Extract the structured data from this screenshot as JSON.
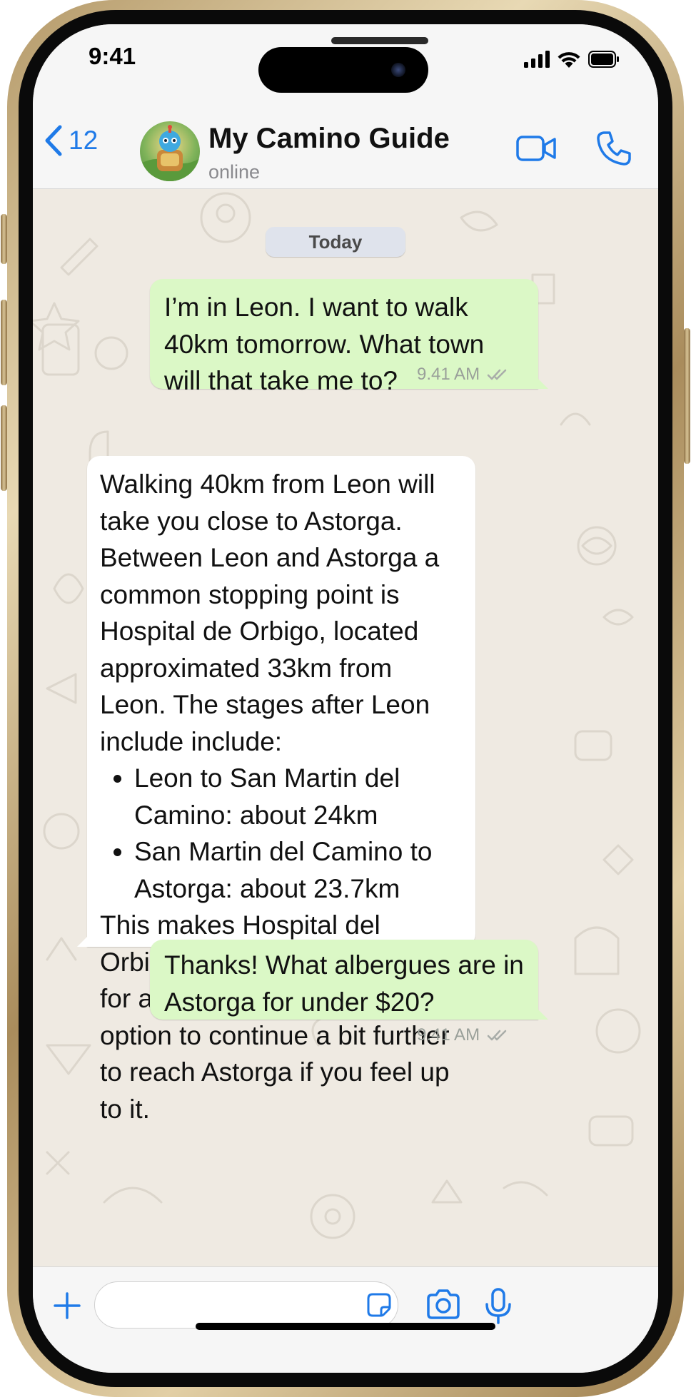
{
  "status_bar": {
    "time": "9:41"
  },
  "header": {
    "back_count": "12",
    "contact_name": "My Camino Guide",
    "contact_status": "online"
  },
  "chat": {
    "date_label": "Today",
    "messages": [
      {
        "direction": "outgoing",
        "text": "I’m in Leon. I want to walk 40km tomorrow. What town will that take me to?",
        "time": "9.41 AM",
        "read": true
      },
      {
        "direction": "incoming",
        "intro": "Walking 40km from Leon will take you close to Astorga. Between Leon and Astorga a common stopping point is Hospital de Orbigo, located approximated 33km from Leon. The stages after Leon include include:",
        "bullets": [
          "Leon to San Martin del Camino: about 24km",
          "San Martin del Camino to Astorga: about 23.7km"
        ],
        "outro": "This makes Hospital del Orbigo a good targeting point for a 40km walk, with the option to continue a bit further to reach Astorga if you feel up to it."
      },
      {
        "direction": "outgoing",
        "text": "Thanks! What albergues are in Astorga for under $20?",
        "time": "9.41 AM",
        "read": true
      }
    ]
  },
  "input_bar": {
    "value": "",
    "placeholder": ""
  },
  "colors": {
    "accent": "#1f7ae8",
    "outgoing_bubble": "#dbf8c6",
    "incoming_bubble": "#ffffff",
    "chat_background": "#efeae2"
  },
  "icons": [
    "back-chevron-icon",
    "video-call-icon",
    "phone-icon",
    "plus-icon",
    "sticker-icon",
    "camera-icon",
    "microphone-icon",
    "double-check-icon",
    "wifi-icon",
    "signal-icon",
    "battery-icon"
  ]
}
